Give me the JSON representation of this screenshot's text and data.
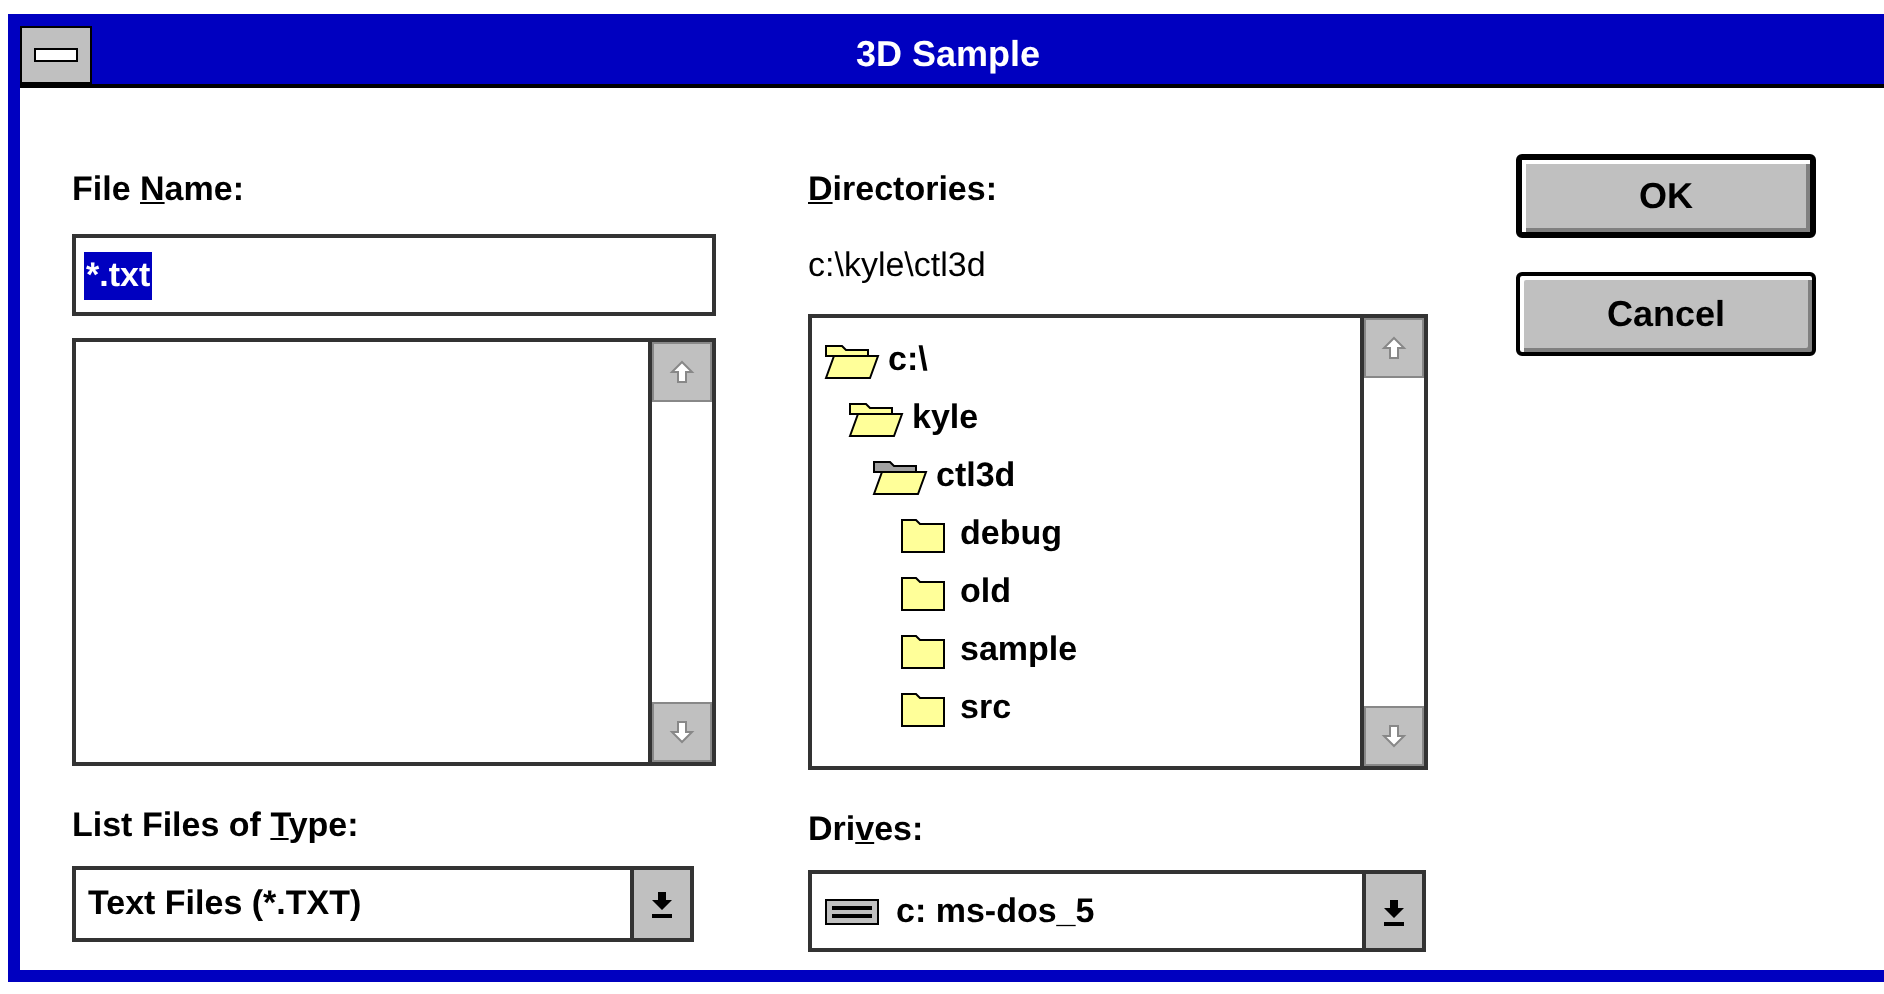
{
  "window": {
    "title": "3D Sample"
  },
  "file_name": {
    "label": [
      {
        "text": "File "
      },
      {
        "text": "N",
        "underline": true
      },
      {
        "text": "ame:"
      }
    ],
    "value": "*.txt"
  },
  "list_type": {
    "label": [
      {
        "text": "List Files of "
      },
      {
        "text": "T",
        "underline": true
      },
      {
        "text": "ype:"
      }
    ],
    "value": "Text Files (*.TXT)"
  },
  "directories": {
    "label": [
      {
        "text": "D",
        "underline": true
      },
      {
        "text": "irectories:"
      }
    ],
    "path": "c:\\kyle\\ctl3d",
    "tree": [
      {
        "name": "c:\\",
        "kind": "open",
        "children": [
          {
            "name": "kyle",
            "kind": "open",
            "children": [
              {
                "name": "ctl3d",
                "kind": "current",
                "children": [
                  {
                    "name": "debug",
                    "kind": "closed"
                  },
                  {
                    "name": "old",
                    "kind": "closed"
                  },
                  {
                    "name": "sample",
                    "kind": "closed"
                  },
                  {
                    "name": "src",
                    "kind": "closed"
                  }
                ]
              }
            ]
          }
        ]
      }
    ]
  },
  "drives": {
    "label": [
      {
        "text": "Dri"
      },
      {
        "text": "v",
        "underline": true
      },
      {
        "text": "es:"
      }
    ],
    "value": "c: ms-dos_5"
  },
  "buttons": [
    {
      "label": "OK",
      "default": true
    },
    {
      "label": "Cancel",
      "default": false
    }
  ]
}
